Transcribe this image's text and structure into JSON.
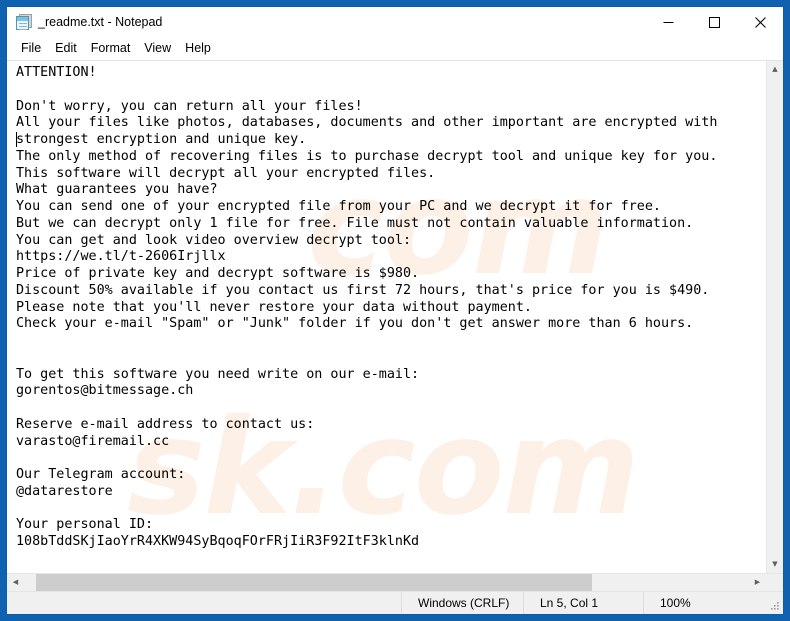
{
  "window": {
    "title": "_readme.txt - Notepad",
    "icon": "notepad-icon",
    "controls": {
      "minimize": "minimize-icon",
      "maximize": "maximize-icon",
      "close": "close-icon"
    }
  },
  "menubar": {
    "items": [
      {
        "label": "File"
      },
      {
        "label": "Edit"
      },
      {
        "label": "Format"
      },
      {
        "label": "View"
      },
      {
        "label": "Help"
      }
    ]
  },
  "document": {
    "text": "ATTENTION!\n\nDon't worry, you can return all your files!\nAll your files like photos, databases, documents and other important are encrypted with\nstrongest encryption and unique key.\nThe only method of recovering files is to purchase decrypt tool and unique key for you.\nThis software will decrypt all your encrypted files.\nWhat guarantees you have?\nYou can send one of your encrypted file from your PC and we decrypt it for free.\nBut we can decrypt only 1 file for free. File must not contain valuable information.\nYou can get and look video overview decrypt tool:\nhttps://we.tl/t-2606Irjllx\nPrice of private key and decrypt software is $980.\nDiscount 50% available if you contact us first 72 hours, that's price for you is $490.\nPlease note that you'll never restore your data without payment.\nCheck your e-mail \"Spam\" or \"Junk\" folder if you don't get answer more than 6 hours.\n\n\nTo get this software you need write on our e-mail:\ngorentos@bitmessage.ch\n\nReserve e-mail address to contact us:\nvarasto@firemail.cc\n\nOur Telegram account:\n@datarestore\n\nYour personal ID:\n108bTddSKjIaoYrR4XKW94SyBqoqFOrFRjIiR3F92ItF3klnKd"
  },
  "watermark": {
    "line1": "com",
    "line2": "sk.com"
  },
  "scrollbars": {
    "vertical": {
      "up": "chevron-up-icon",
      "down": "chevron-down-icon"
    },
    "horizontal": {
      "left": "chevron-left-icon",
      "right": "chevron-right-icon"
    }
  },
  "statusbar": {
    "line_ending": "Windows (CRLF)",
    "position": "Ln 5, Col 1",
    "zoom": "100%"
  },
  "colors": {
    "desktop": "#0f62b0",
    "window_bg": "#ffffff",
    "status_bg": "#f0f0f0",
    "scroll_thumb": "#cdcdcd",
    "watermark": "#fdf0e6"
  }
}
